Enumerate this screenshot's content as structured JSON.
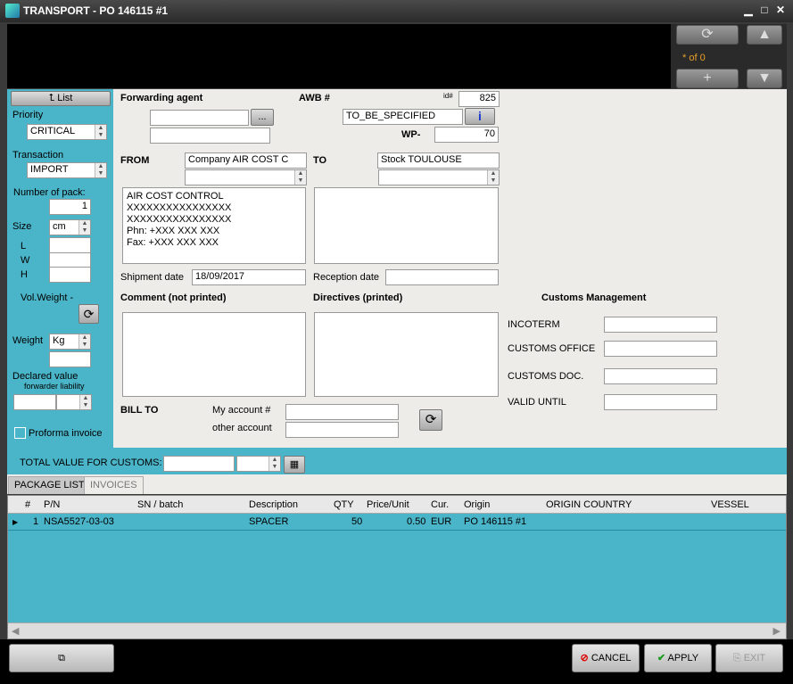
{
  "window": {
    "title": "TRANSPORT  -  PO 146115 #1",
    "minimize": "▁",
    "maximize": "□",
    "close": "✕"
  },
  "nav": {
    "counter": "* of 0",
    "refresh_icon": "refresh-icon",
    "up_icon": "up-arrow-icon",
    "add_icon": "plus-icon",
    "down_icon": "down-arrow-icon"
  },
  "sidebar": {
    "list_label": "List",
    "priority_label": "Priority",
    "priority_value": "CRITICAL",
    "transaction_label": "Transaction",
    "transaction_value": "IMPORT",
    "num_pack_label": "Number of pack:",
    "num_pack_value": "1",
    "size_label": "Size",
    "size_unit": "cm",
    "l_label": "L",
    "w_label": "W",
    "h_label": "H",
    "volweight_label": "Vol.Weight  -",
    "weight_label": "Weight",
    "weight_unit": "Kg",
    "declared_label": "Declared value",
    "forwarder_liability": "forwarder liability",
    "proforma_label": "Proforma invoice"
  },
  "form": {
    "forwarding_agent_label": "Forwarding agent",
    "dots": "...",
    "awb_label": "AWB #",
    "id_label": "id#",
    "id_value": "825",
    "awb_value": "TO_BE_SPECIFIED",
    "info_icon": "i",
    "wp_label": "WP-",
    "wp_value": "70",
    "from_label": "FROM",
    "from_value": "Company AIR COST C",
    "to_label": "TO",
    "to_value": "Stock TOULOUSE",
    "from_address": "AIR COST CONTROL\nXXXXXXXXXXXXXXXX\nXXXXXXXXXXXXXXXX\nPhn: +XXX XXX XXX\nFax: +XXX XXX XXX",
    "shipment_label": "Shipment date",
    "shipment_value": "18/09/2017",
    "reception_label": "Reception date",
    "comment_label": "Comment (not printed)",
    "directives_label": "Directives (printed)",
    "customs_label": "Customs Management",
    "incoterm_label": "INCOTERM",
    "customs_office_label": "CUSTOMS OFFICE",
    "customs_doc_label": "CUSTOMS DOC.",
    "valid_until_label": "VALID UNTIL",
    "bill_to_label": "BILL TO",
    "my_account_label": "My account #",
    "other_account_label": "other account"
  },
  "customs_total": {
    "label": "TOTAL VALUE FOR CUSTOMS:"
  },
  "tabs": [
    {
      "label": "PACKAGE LIST"
    },
    {
      "label": "INVOICES"
    }
  ],
  "grid": {
    "headers": [
      "#",
      "P/N",
      "SN / batch",
      "Description",
      "QTY",
      "Price/Unit",
      "Cur.",
      "Origin",
      "ORIGIN COUNTRY",
      "VESSEL"
    ],
    "rows": [
      {
        "num": "1",
        "pn": "NSA5527-03-03",
        "sn": "",
        "desc": "SPACER",
        "qty": "50",
        "price": "0.50",
        "cur": "EUR",
        "origin": "PO 146115 #1",
        "country": "",
        "vessel": ""
      }
    ]
  },
  "buttons": {
    "cancel": "CANCEL",
    "apply": "APPLY",
    "exit": "EXIT"
  }
}
